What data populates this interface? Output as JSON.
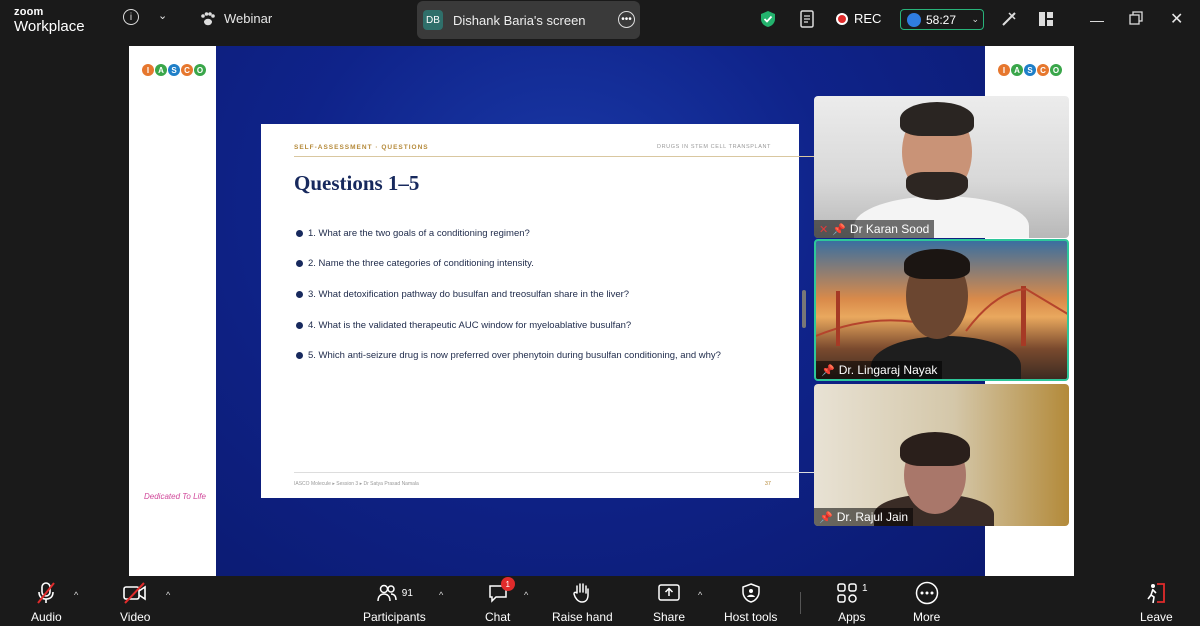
{
  "app": {
    "brand_top": "zoom",
    "brand_bottom": "Workplace"
  },
  "topbar": {
    "webinar_label": "Webinar",
    "share_initials": "DB",
    "share_name": "Dishank Baria's screen",
    "rec_label": "REC",
    "timer": "58:27"
  },
  "slide": {
    "logo_letters": [
      "I",
      "A",
      "S",
      "C",
      "O"
    ],
    "section": "SELF-ASSESSMENT · QUESTIONS",
    "topic": "DRUGS IN STEM CELL TRANSPLANT",
    "title": "Questions 1–5",
    "questions": [
      "1.  What are the two goals of a conditioning regimen?",
      "2.  Name the three categories of conditioning intensity.",
      "3.  What detoxification pathway do busulfan and treosulfan share in the liver?",
      "4.  What is the validated therapeutic AUC window for myeloablative busulfan?",
      "5.  Which anti-seizure drug is now preferred over phenytoin during busulfan conditioning, and why?"
    ],
    "footer": "IASCO Molecule  ▸  Session 3  ▸  Dr Satya Prasad Namala",
    "page_number": "37",
    "dedicated": "Dedicated To Life"
  },
  "participants": [
    {
      "name": "Dr Karan Sood",
      "muted": true,
      "pinned": true
    },
    {
      "name": "Dr. Lingaraj Nayak",
      "muted": false,
      "pinned": true
    },
    {
      "name": "Dr. Rajul Jain",
      "muted": false,
      "pinned": true
    }
  ],
  "toolbar": {
    "audio": "Audio",
    "video": "Video",
    "participants": "Participants",
    "participants_count": "91",
    "chat": "Chat",
    "chat_badge": "1",
    "raise_hand": "Raise hand",
    "share": "Share",
    "host_tools": "Host tools",
    "apps": "Apps",
    "apps_count": "1",
    "more": "More",
    "leave": "Leave"
  },
  "colors": {
    "accent_green": "#2ec79a",
    "rec_red": "#e02b2b",
    "slide_navy": "#17295d",
    "leave_red": "#e02b2b"
  }
}
